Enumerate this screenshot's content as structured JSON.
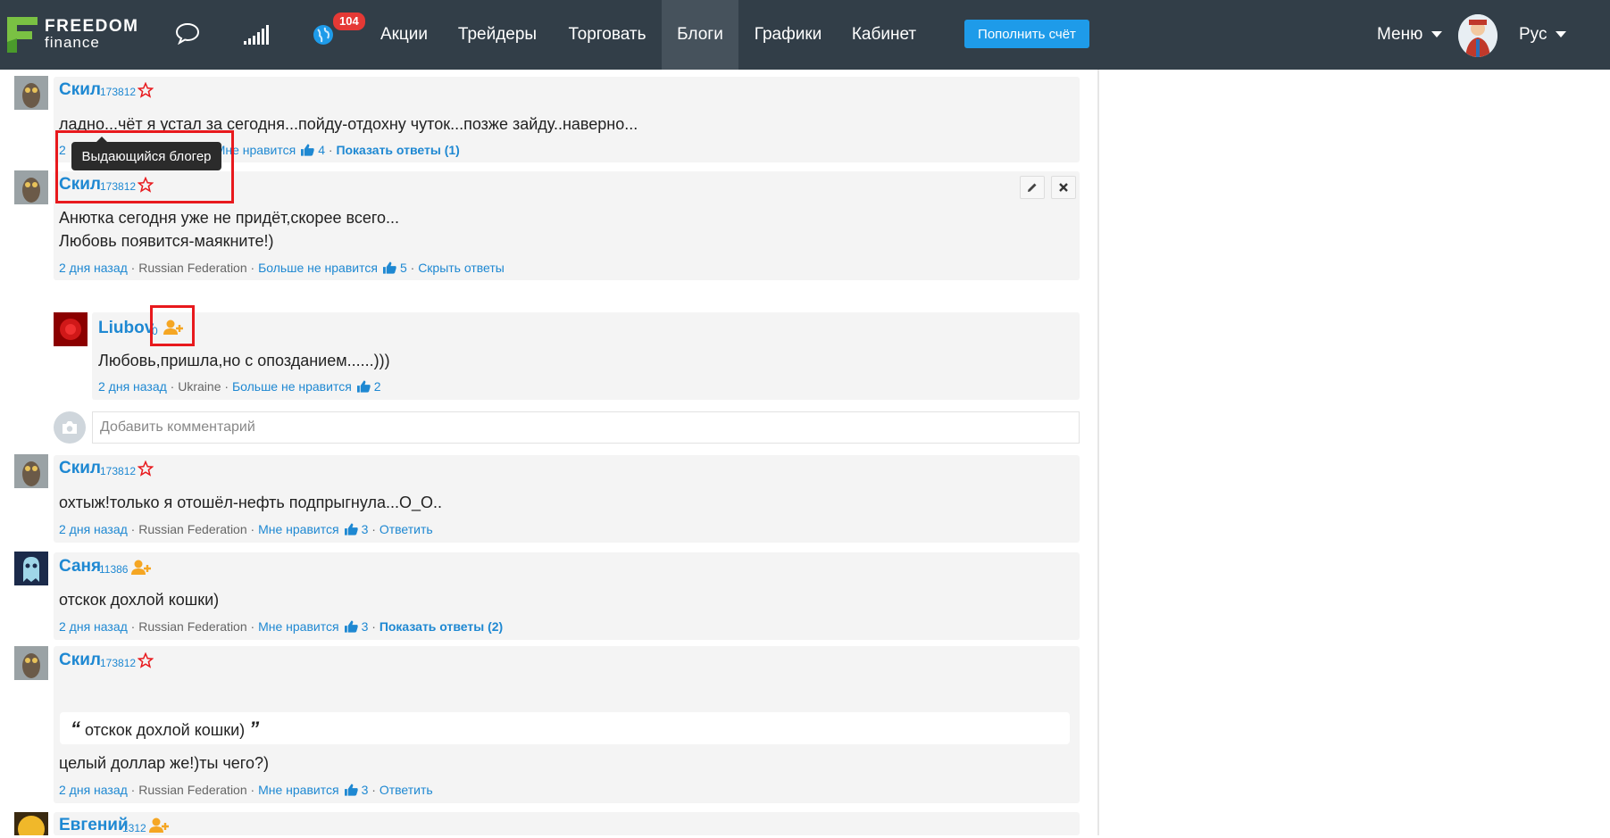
{
  "header": {
    "logo": {
      "line1": "FREEDOM",
      "line2": "finance"
    },
    "notification_count": "104",
    "nav": [
      "Акции",
      "Трейдеры",
      "Торговать",
      "Блоги",
      "Графики",
      "Кабинет"
    ],
    "active_nav": "Блоги",
    "topup_label": "Пополнить счёт",
    "menu_label": "Меню",
    "lang_label": "Рус"
  },
  "tooltip": "Выдающийся блогер",
  "add_comment_placeholder": "Добавить комментарий",
  "meta_sep": "·",
  "comments": [
    {
      "user": "Скил",
      "rating": "173812",
      "text_lines": [
        "ладно...чёт я устал за сегодня...пойду-отдохну чуток...позже зайду..наверно..."
      ],
      "time": "2",
      "country": "tion",
      "like": "Мне нравится",
      "likes": "4",
      "action": "Показать ответы (1)"
    },
    {
      "user": "Скил",
      "rating": "173812",
      "text_lines": [
        "Анютка сегодня уже не придёт,скорее всего...",
        "Любовь появится-маякните!)"
      ],
      "time": "2 дня назад",
      "country": "Russian Federation",
      "like": "Больше не нравится",
      "likes": "5",
      "action": "Скрыть ответы"
    },
    {
      "user": "Liubov",
      "rating": "0",
      "text_lines": [
        "Любовь,пришла,но с опозданием......)))"
      ],
      "time": "2 дня назад",
      "country": "Ukraine",
      "like": "Больше не нравится",
      "likes": "2"
    },
    {
      "user": "Скил",
      "rating": "173812",
      "text_lines": [
        "охтыж!только я отошёл-нефть подпрыгнула...О_О.."
      ],
      "time": "2 дня назад",
      "country": "Russian Federation",
      "like": "Мне нравится",
      "likes": "3",
      "action": "Ответить"
    },
    {
      "user": "Саня",
      "rating": "11386",
      "text_lines": [
        "отскок дохлой кошки)"
      ],
      "time": "2 дня назад",
      "country": "Russian Federation",
      "like": "Мне нравится",
      "likes": "3",
      "action": "Показать ответы (2)"
    },
    {
      "user": "Скил",
      "rating": "173812",
      "quote": "отскок дохлой кошки)",
      "text_lines": [
        "целый доллар же!)ты чего?)"
      ],
      "time": "2 дня назад",
      "country": "Russian Federation",
      "like": "Мне нравится",
      "likes": "3",
      "action": "Ответить"
    },
    {
      "user": "Евгений",
      "rating": "1312"
    }
  ],
  "colors": {
    "header_bg": "#323e48",
    "link": "#1e88d2",
    "accent_button": "#1e9be9",
    "highlight": "#e8191d",
    "follow_icon": "#f5a623",
    "star_icon": "#e8191d"
  }
}
